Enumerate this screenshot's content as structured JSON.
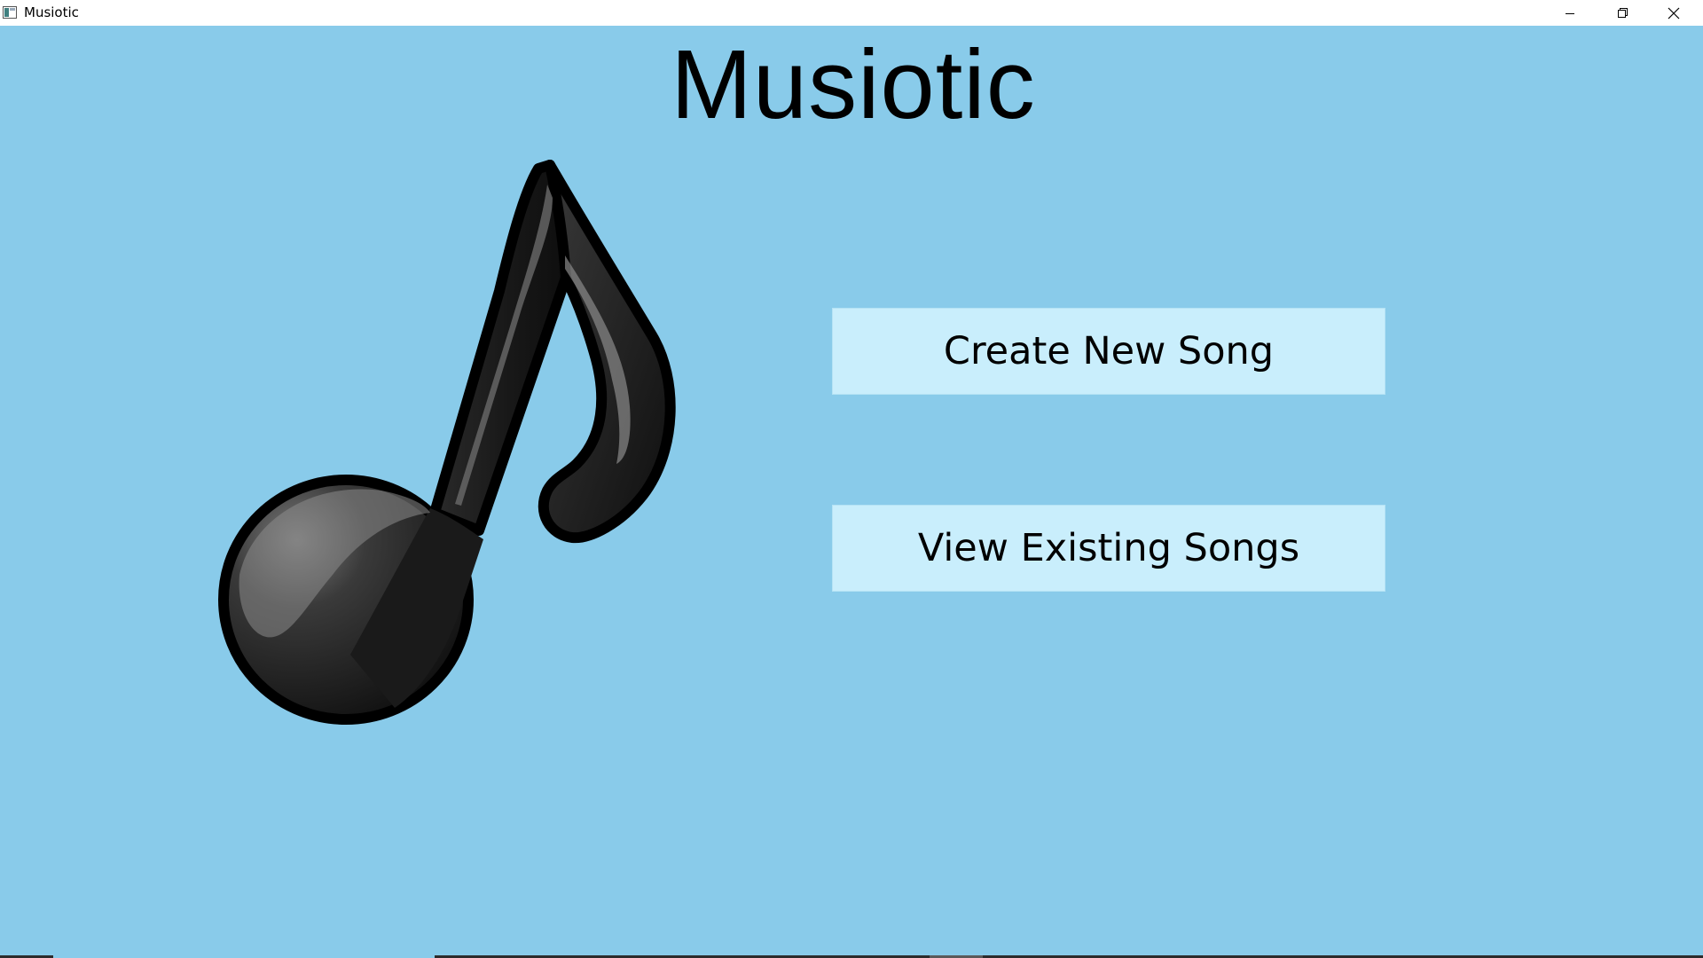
{
  "window": {
    "title": "Musiotic",
    "controls": {
      "minimize": "minimize-icon",
      "maximize": "restore-icon",
      "close": "close-icon"
    }
  },
  "app": {
    "heading": "Musiotic",
    "logo": "music-note-icon"
  },
  "menu": {
    "create_label": "Create New Song",
    "view_label": "View Existing Songs"
  },
  "colors": {
    "background": "#89cbea",
    "button_fill": "#c9eefc",
    "text": "#000000"
  }
}
